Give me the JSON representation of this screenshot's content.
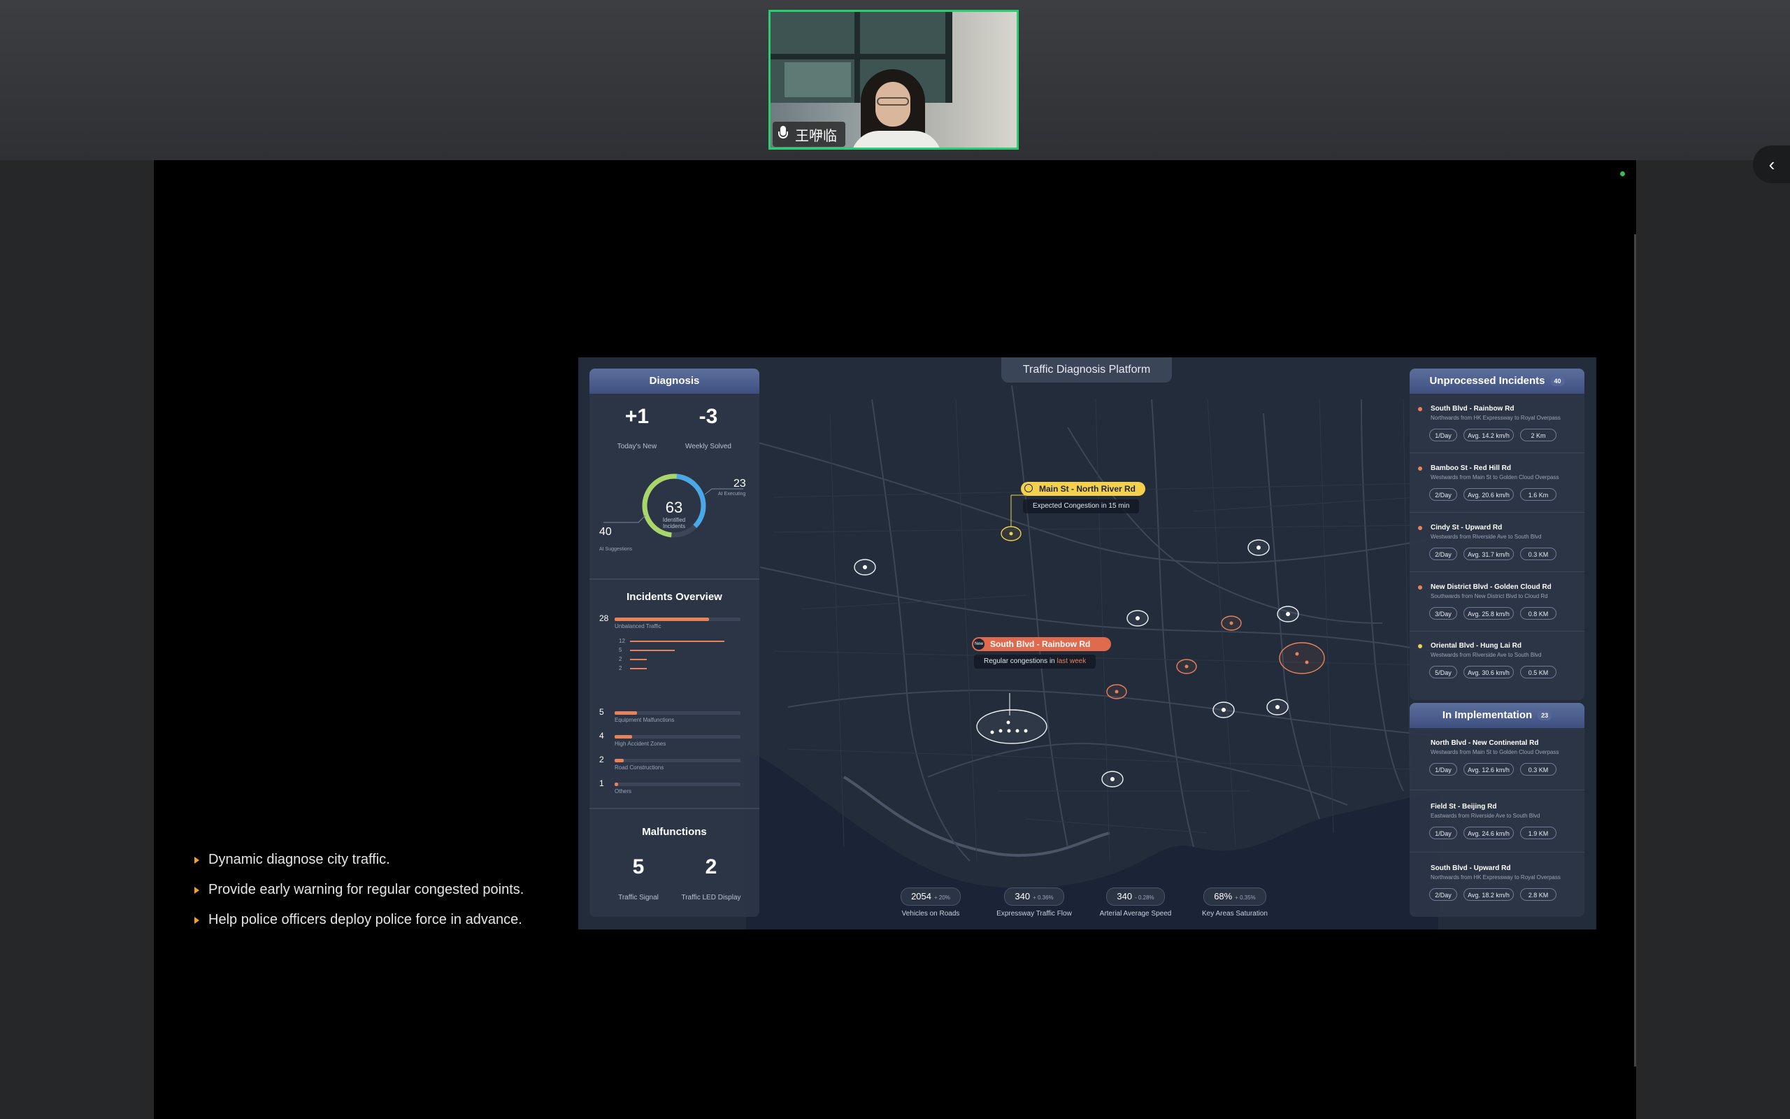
{
  "meeting": {
    "participant_name": "王咿临",
    "collapse_icon": "‹"
  },
  "bullets": [
    "Dynamic diagnose city traffic.",
    "Provide early warning for regular congested points.",
    "Help police officers deploy police force in advance."
  ],
  "dashboard": {
    "platform_title": "Traffic Diagnosis Platform",
    "diagnosis": {
      "title": "Diagnosis",
      "todays_new_value": "+1",
      "todays_new_label": "Today's New",
      "weekly_solved_value": "-3",
      "weekly_solved_label": "Weekly Solved",
      "identified_value": "63",
      "identified_label": "Identified Incidents",
      "ai_executing_value": "23",
      "ai_executing_label": "AI Executing",
      "ai_suggestions_value": "40",
      "ai_suggestions_label": "AI Suggestions"
    },
    "overview": {
      "title": "Incidents Overview",
      "main": {
        "value": "28",
        "label": "Unbalanced Traffic",
        "fraction": 0.75
      },
      "sub_values": [
        "12",
        "5",
        "2",
        "2"
      ],
      "bars": [
        {
          "value": "5",
          "label": "Equipment Malfunctions",
          "fraction": 0.18
        },
        {
          "value": "4",
          "label": "High Accident Zones",
          "fraction": 0.14
        },
        {
          "value": "2",
          "label": "Road Constructions",
          "fraction": 0.07
        },
        {
          "value": "1",
          "label": "Others",
          "fraction": 0.03
        }
      ]
    },
    "malfunctions": {
      "title": "Malfunctions",
      "signal_value": "5",
      "signal_label": "Traffic Signal",
      "led_value": "2",
      "led_label": "Traffic LED Display"
    },
    "unprocessed": {
      "title": "Unprocessed Incidents",
      "count": "40",
      "items": [
        {
          "title": "South Blvd - Rainbow Rd",
          "desc": "Northwards from HK Expressway to Royal Overpass",
          "freq": "1/Day",
          "speed": "Avg. 14.2 km/h",
          "dist": "2 Km",
          "color": "#e8825a"
        },
        {
          "title": "Bamboo St - Red Hill Rd",
          "desc": "Westwards from Main St to Golden Cloud Overpass",
          "freq": "2/Day",
          "speed": "Avg. 20.6 km/h",
          "dist": "1.6 Km",
          "color": "#e8825a"
        },
        {
          "title": "Cindy St - Upward Rd",
          "desc": "Westwards from Riverside Ave to South Blvd",
          "freq": "2/Day",
          "speed": "Avg. 31.7 km/h",
          "dist": "0.3 KM",
          "color": "#e8825a"
        },
        {
          "title": "New District Blvd - Golden Cloud Rd",
          "desc": "Southwards from New District Blvd to Cloud Rd",
          "freq": "3/Day",
          "speed": "Avg. 25.8 km/h",
          "dist": "0.8 KM",
          "color": "#e8825a"
        },
        {
          "title": "Oriental Blvd - Hung Lai Rd",
          "desc": "Westwards from Riverside Ave to South Blvd",
          "freq": "5/Day",
          "speed": "Avg. 30.6 km/h",
          "dist": "0.5 KM",
          "color": "#f5d04a"
        }
      ]
    },
    "implementation": {
      "title": "In Implementation",
      "count": "23",
      "items": [
        {
          "title": "North Blvd - New Continental Rd",
          "desc": "Westwards from Main St to Golden Cloud Overpass",
          "freq": "1/Day",
          "speed": "Avg. 12.6 km/h",
          "dist": "0.3 KM"
        },
        {
          "title": "Field St - Beijing Rd",
          "desc": "Eastwards from Riverside Ave to South Blvd",
          "freq": "1/Day",
          "speed": "Avg. 24.6 km/h",
          "dist": "1.9 KM"
        },
        {
          "title": "South Blvd - Upward Rd",
          "desc": "Northwards from HK Expressway to Royal Overpass",
          "freq": "2/Day",
          "speed": "Avg. 18.2 km/h",
          "dist": "2.8 KM"
        }
      ]
    },
    "map_tags": {
      "warning_title": "Main St - North River Rd",
      "warning_sub": "Expected Congestion in 15 min",
      "alert_title": "South Blvd - Rainbow Rd",
      "alert_badge": "New",
      "alert_sub_prefix": "Regular congestions in",
      "alert_sub_highlight": "last week"
    },
    "stats": [
      {
        "value": "2054",
        "delta": "+ 20%",
        "label": "Vehicles on Roads"
      },
      {
        "value": "340",
        "delta": "+ 0.36%",
        "label": "Expressway Traffic Flow"
      },
      {
        "value": "340",
        "delta": "- 0.28%",
        "label": "Arterial Average Speed"
      },
      {
        "value": "68%",
        "delta": "+ 0.35%",
        "label": "Key Areas Saturation"
      }
    ]
  }
}
